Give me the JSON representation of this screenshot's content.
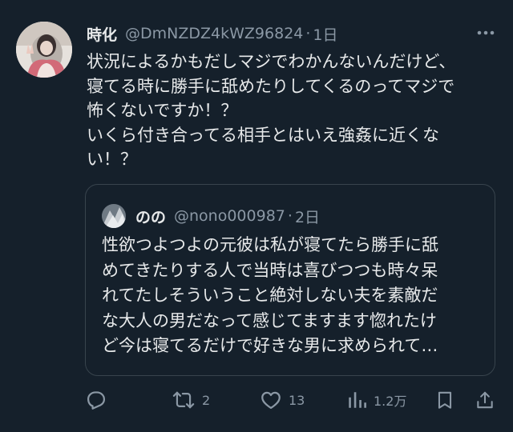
{
  "tweet": {
    "author": {
      "display_name": "時化",
      "handle": "@DmNZDZ4kWZ96824",
      "separator": "·",
      "time": "1日"
    },
    "text_lines": [
      "状況によるかもだしマジでわかんないんだけど、",
      "寝てる時に勝手に舐めたりしてくるのってマジで",
      "怖くないですか！？",
      "いくら付き合ってる相手とはいえ強姦に近くな",
      "い！？"
    ],
    "more_icon": "more-horizontal-icon"
  },
  "quote": {
    "author": {
      "display_name": "のの",
      "handle": "@nono000987",
      "separator": "·",
      "time": "2日"
    },
    "text_lines": [
      "性欲つよつよの元彼は私が寝てたら勝手に舐",
      "めてきたりする人で当時は喜びつつも時々呆",
      "れてたしそういうこと絶対しない夫を素敵だ",
      "な大人の男だなって感じてますます惚れたけ",
      "ど今は寝てるだけで好きな男に求められて…"
    ]
  },
  "actions": {
    "reply": {
      "icon": "reply-icon",
      "count": ""
    },
    "retweet": {
      "icon": "retweet-icon",
      "count": "2"
    },
    "like": {
      "icon": "heart-icon",
      "count": "13"
    },
    "views": {
      "icon": "views-icon",
      "count": "1.2万"
    },
    "bookmark": {
      "icon": "bookmark-icon",
      "count": ""
    },
    "share": {
      "icon": "share-icon",
      "count": ""
    }
  },
  "colors": {
    "background": "#15202b",
    "text_primary": "#e7e9ea",
    "text_secondary": "#8b98a5",
    "border": "#38444d"
  }
}
